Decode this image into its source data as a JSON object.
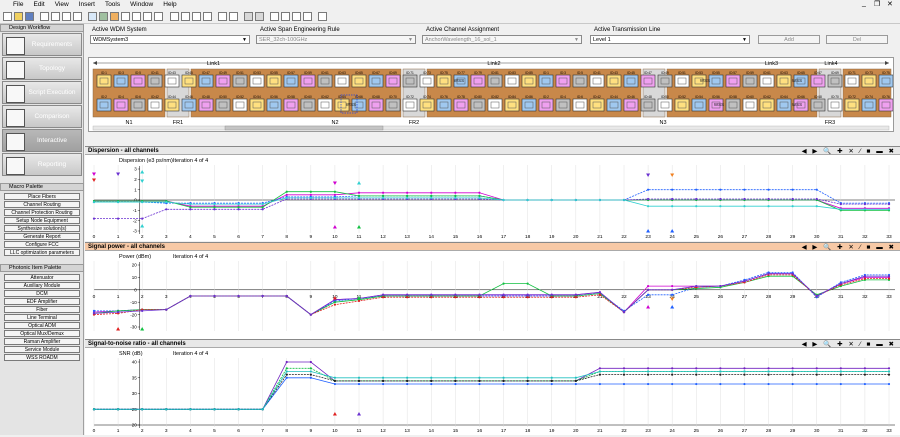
{
  "menu": [
    "File",
    "Edit",
    "View",
    "Insert",
    "Tools",
    "Window",
    "Help"
  ],
  "sidebar": {
    "workflow_title": "Design Workflow",
    "workflow_items": [
      "Requirements",
      "Topology",
      "Script Execution",
      "Comparison",
      "Interactive",
      "Reporting"
    ],
    "macro_title": "Macro Palette",
    "macro_items": [
      "Place Fibers",
      "Channel Routing",
      "Channel Protection Routing",
      "Setup Node Equipment",
      "Synthesize solution(s)",
      "Generate Report",
      "Configure FCC",
      "LLC optimization parameters"
    ],
    "photonic_title": "Photonic Item Palette",
    "photonic_items": [
      "Attenuator",
      "Auxiliary Module",
      "DCM",
      "EDF Amplifier",
      "Fiber",
      "Line Terminal",
      "Optical ADM",
      "Optical Mux/Demux",
      "Raman Amplifier",
      "Service Module",
      "WSS ROADM"
    ]
  },
  "controls": {
    "wdm_label": "Active WDM System",
    "wdm_value": "WDMSystem3",
    "span_label": "Active Span Engineering Rule",
    "span_value": "SER_32ch-100GHz",
    "channel_label": "Active Channel Assignment",
    "channel_value": "AnchorWavelength_16_sol_1",
    "line_label": "Active Transmission Line",
    "line_value": "Level 1",
    "add_label": "Add",
    "del_label": "Del"
  },
  "topology": {
    "links": [
      "Link1",
      "Link2",
      "Link3",
      "Link4"
    ],
    "nodes": [
      "N1",
      "FR1",
      "N2",
      "FR2",
      "N3",
      "FR3"
    ],
    "device_labels": [
      "ID:1",
      "ID:2",
      "ID:3",
      "ID:4",
      "ID:5",
      "ID:6",
      "ID:41",
      "ID:42",
      "ID:43",
      "ID:44",
      "ID:45",
      "ID:46",
      "ID:47",
      "ID:48",
      "ID:49",
      "ID:50",
      "ID:51",
      "ID:52",
      "ID:53",
      "ID:54",
      "ID:55",
      "ID:56",
      "ID:57",
      "ID:58",
      "ID:59",
      "ID:60",
      "ID:61",
      "ID:62",
      "ID:63",
      "ID:64",
      "ID:65",
      "ID:66",
      "ID:67",
      "ID:68",
      "ID:69",
      "ID:70",
      "ID:71",
      "ID:72",
      "ID:73",
      "ID:74",
      "ID:75",
      "ID:76",
      "ID:77",
      "ID:78",
      "ID:79",
      "ID:80",
      "ID:81",
      "ID:82",
      "ID:83",
      "ID:84",
      "ID:85",
      "ID:86"
    ],
    "wss_label": "WSS"
  },
  "sections": [
    {
      "title": "Dispersion - all channels",
      "header_color": "#e8e8e8",
      "ylabel": "Dispersion (e3 ps/nm)",
      "iteration": "Iteration 4 of 4"
    },
    {
      "title": "Signal power - all channels",
      "header_color": "#f7c9a6",
      "ylabel": "Power (dBm)",
      "iteration": "Iteration 4 of 4"
    },
    {
      "title": "Signal-to-noise ratio - all channels",
      "header_color": "#e8e8e8",
      "ylabel": "SNR (dB)",
      "iteration": "Iteration 4 of 4"
    }
  ],
  "toolbar_icons": [
    "left-arrow",
    "right-arrow",
    "zoom-out",
    "zoom-in",
    "fit",
    "analysis",
    "dots",
    "close"
  ],
  "chart_data": [
    {
      "type": "line",
      "title": "Dispersion - all channels",
      "ylabel": "Dispersion (e3 ps/nm)",
      "x": [
        0,
        1,
        2,
        3,
        4,
        5,
        6,
        7,
        8,
        9,
        10,
        11,
        12,
        13,
        14,
        15,
        16,
        17,
        18,
        19,
        20,
        21,
        22,
        23,
        24,
        25,
        26,
        27,
        28,
        29,
        30,
        31,
        32,
        33
      ],
      "ylim": [
        -3,
        3
      ],
      "series": [
        {
          "name": "magenta",
          "color": "#d000d0",
          "values": [
            -0.1,
            -0.1,
            -0.1,
            -0.1,
            -0.6,
            -0.6,
            -0.6,
            -0.6,
            0.5,
            0.5,
            0.5,
            0.7,
            0.7,
            0.7,
            0.7,
            0.7,
            0.7,
            0.0,
            0.0,
            0.0,
            0.0,
            0.0,
            0.0,
            0.0,
            0.0,
            0.0,
            0.0,
            0.0,
            0.0,
            0.0,
            0.0,
            -0.8,
            -0.8,
            -0.8
          ]
        },
        {
          "name": "blue",
          "color": "#2060ff",
          "values": [
            -0.2,
            -0.2,
            -0.2,
            -0.3,
            -0.3,
            -0.3,
            -0.3,
            -0.3,
            0.3,
            0.3,
            0.3,
            0.4,
            0.4,
            0.4,
            0.4,
            0.4,
            0.4,
            0.0,
            0.0,
            0.0,
            0.0,
            0.0,
            0.0,
            1.0,
            1.0,
            1.0,
            1.0,
            1.0,
            1.0,
            1.0,
            1.0,
            -0.3,
            -0.3,
            -0.3
          ]
        },
        {
          "name": "green",
          "color": "#10c040",
          "values": [
            -0.1,
            -0.1,
            -0.1,
            -0.1,
            -0.7,
            -0.7,
            -0.7,
            -0.7,
            0.8,
            0.8,
            0.8,
            0.4,
            0.4,
            0.4,
            0.4,
            0.4,
            0.4,
            0.0,
            0.0,
            0.0,
            0.0,
            0.0,
            0.0,
            0.0,
            0.0,
            0.0,
            0.0,
            0.0,
            0.0,
            0.0,
            0.0,
            -1.0,
            -1.0,
            -1.0
          ]
        },
        {
          "name": "purple",
          "color": "#6a30d0",
          "values": [
            -1.8,
            -1.8,
            -1.8,
            -0.9,
            -0.9,
            -0.9,
            -0.9,
            -0.9,
            0.1,
            0.1,
            0.1,
            0.1,
            0.1,
            0.1,
            0.1,
            0.1,
            0.1,
            0.0,
            0.0,
            0.0,
            0.0,
            0.0,
            0.0,
            0.1,
            0.1,
            0.1,
            0.1,
            0.1,
            0.1,
            0.1,
            0.1,
            -0.4,
            -0.4,
            -0.4
          ]
        },
        {
          "name": "cyan",
          "color": "#30d0d0",
          "values": [
            -0.2,
            -0.2,
            -0.2,
            -0.2,
            -0.4,
            -0.4,
            -0.4,
            -0.4,
            0.2,
            0.2,
            0.2,
            0.2,
            0.2,
            0.2,
            0.2,
            0.2,
            0.2,
            0.0,
            0.0,
            0.0,
            0.0,
            0.0,
            0.0,
            -0.6,
            -0.6,
            -0.6,
            -0.6,
            -0.6,
            -0.6,
            -0.6,
            -0.6,
            -0.9,
            -0.9,
            -0.9
          ]
        }
      ]
    },
    {
      "type": "line",
      "title": "Signal power - all channels",
      "ylabel": "Power (dBm)",
      "x": [
        0,
        1,
        2,
        3,
        4,
        5,
        6,
        7,
        8,
        9,
        10,
        11,
        12,
        13,
        14,
        15,
        16,
        17,
        18,
        19,
        20,
        21,
        22,
        23,
        24,
        25,
        26,
        27,
        28,
        29,
        30,
        31,
        32,
        33
      ],
      "ylim": [
        -30,
        20
      ],
      "series": [
        {
          "name": "magenta",
          "color": "#d000d0",
          "values": [
            -18,
            -17,
            -16,
            -16,
            -5,
            -5,
            -5,
            -5,
            -5,
            -20,
            -8,
            -7,
            -4,
            -4,
            -4,
            -4,
            -4,
            -4,
            -4,
            -4,
            -4,
            -2,
            -18,
            3,
            3,
            3,
            3,
            7,
            13,
            13,
            -5,
            5,
            10,
            10
          ]
        },
        {
          "name": "blue",
          "color": "#2060ff",
          "values": [
            -17,
            -17,
            -16,
            -16,
            -5,
            -5,
            -5,
            -5,
            -5,
            -20,
            -9,
            -7,
            -5,
            -5,
            -5,
            -5,
            -5,
            -5,
            -5,
            -5,
            -5,
            -3,
            -17,
            -4,
            -4,
            2,
            3,
            8,
            14,
            14,
            -6,
            6,
            12,
            12
          ]
        },
        {
          "name": "green",
          "color": "#10c040",
          "values": [
            -19,
            -17,
            -16,
            -16,
            -5,
            -5,
            -5,
            -5,
            -5,
            -20,
            -10,
            -8,
            -5,
            -5,
            -5,
            -5,
            -5,
            5,
            5,
            -5,
            -5,
            -3,
            -18,
            0,
            0,
            1,
            2,
            6,
            11,
            11,
            -4,
            3,
            8,
            8
          ]
        },
        {
          "name": "red",
          "color": "#e02020",
          "values": [
            -20,
            -19,
            -16,
            -16,
            -5,
            -5,
            -5,
            -5,
            -5,
            -20,
            -12,
            -9,
            -6,
            -6,
            -6,
            -6,
            -6,
            -6,
            -6,
            -6,
            -6,
            -4,
            -18,
            0,
            0,
            2,
            3,
            6,
            12,
            12,
            -5,
            4,
            9,
            9
          ]
        },
        {
          "name": "purple",
          "color": "#6a30d0",
          "values": [
            -19,
            -18,
            -17,
            -16,
            -5,
            -5,
            -5,
            -5,
            -5,
            -20,
            -8,
            -7,
            -4,
            -4,
            -4,
            -4,
            -4,
            -4,
            -4,
            -4,
            -4,
            -2,
            -18,
            0,
            0,
            3,
            3,
            7,
            13,
            13,
            -5,
            5,
            11,
            11
          ]
        }
      ]
    },
    {
      "type": "line",
      "title": "Signal-to-noise ratio - all channels",
      "ylabel": "SNR (dB)",
      "x": [
        0,
        1,
        2,
        3,
        4,
        5,
        6,
        7,
        8,
        9,
        10,
        11,
        12,
        13,
        14,
        15,
        16,
        17,
        18,
        19,
        20,
        21,
        22,
        23,
        24,
        25,
        26,
        27,
        28,
        29,
        30,
        31,
        32,
        33
      ],
      "ylim": [
        20,
        40
      ],
      "series": [
        {
          "name": "purple",
          "color": "#7020c0",
          "values": [
            25,
            25,
            25,
            25,
            25,
            25,
            25,
            25,
            40,
            40,
            34,
            34,
            34,
            34,
            34,
            34,
            34,
            34,
            34,
            34,
            34,
            38,
            38,
            38,
            38,
            38,
            38,
            38,
            38,
            38,
            38,
            38,
            38,
            38
          ]
        },
        {
          "name": "green",
          "color": "#10c040",
          "values": [
            25,
            25,
            25,
            25,
            25,
            25,
            25,
            25,
            38,
            38,
            34,
            34,
            34,
            34,
            34,
            34,
            34,
            34,
            34,
            34,
            34,
            37,
            37,
            37,
            37,
            37,
            37,
            37,
            37,
            37,
            37,
            37,
            37,
            37
          ]
        },
        {
          "name": "blue",
          "color": "#2060ff",
          "values": [
            25,
            25,
            25,
            25,
            25,
            25,
            25,
            25,
            35,
            35,
            33,
            33,
            33,
            33,
            33,
            33,
            33,
            33,
            33,
            33,
            33,
            33,
            33,
            33,
            33,
            33,
            33,
            33,
            33,
            33,
            33,
            33,
            33,
            33
          ]
        },
        {
          "name": "black",
          "color": "#202020",
          "values": [
            25,
            25,
            25,
            25,
            25,
            25,
            25,
            25,
            36,
            36,
            34,
            34,
            34,
            34,
            34,
            34,
            34,
            34,
            34,
            34,
            34,
            36,
            36,
            36,
            36,
            36,
            36,
            36,
            36,
            36,
            36,
            36,
            36,
            36
          ]
        },
        {
          "name": "cyan",
          "color": "#20c0c0",
          "values": [
            25,
            25,
            25,
            25,
            25,
            25,
            25,
            25,
            37,
            37,
            35,
            35,
            35,
            35,
            35,
            35,
            35,
            35,
            35,
            35,
            35,
            37,
            37,
            37,
            37,
            37,
            37,
            37,
            37,
            37,
            37,
            37,
            37,
            37
          ]
        }
      ]
    }
  ]
}
